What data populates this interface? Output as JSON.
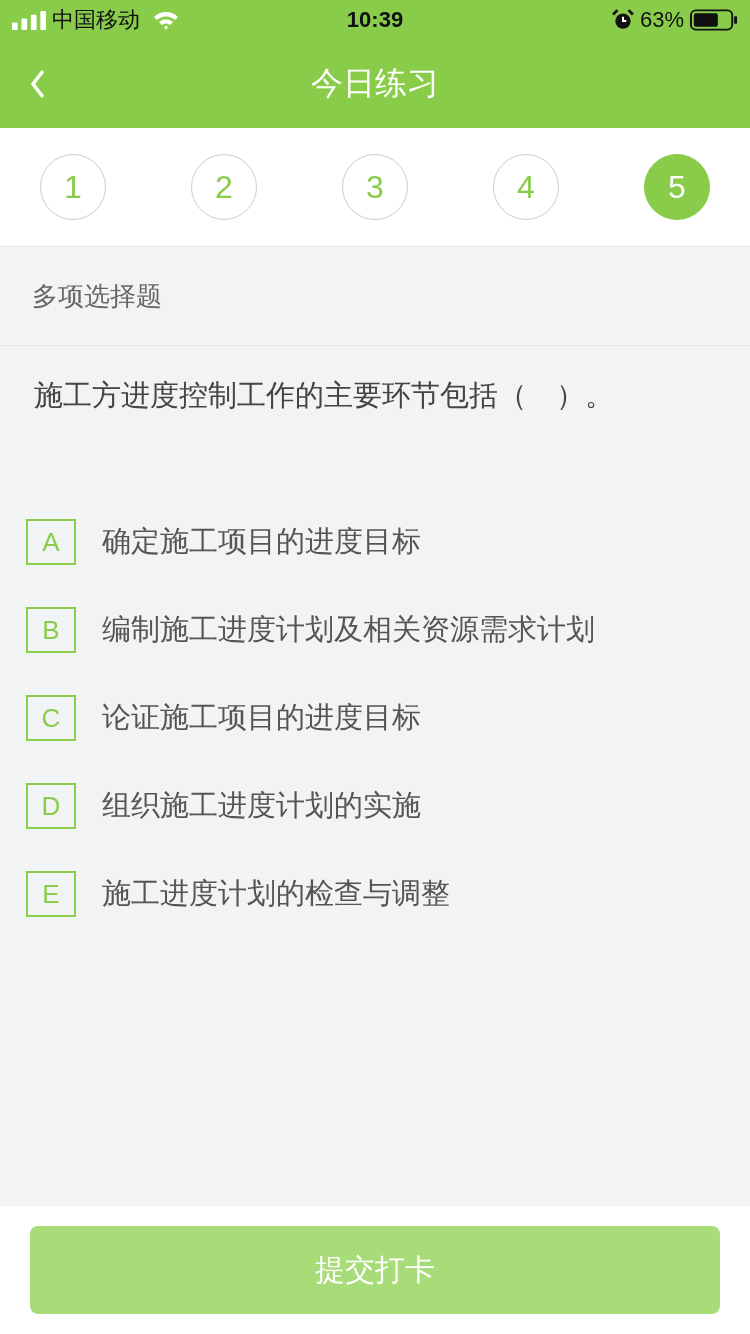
{
  "status_bar": {
    "carrier": "中国移动",
    "time": "10:39",
    "battery_text": "63%"
  },
  "nav": {
    "title": "今日练习"
  },
  "steps": [
    {
      "label": "1",
      "selected": false
    },
    {
      "label": "2",
      "selected": false
    },
    {
      "label": "3",
      "selected": false
    },
    {
      "label": "4",
      "selected": false
    },
    {
      "label": "5",
      "selected": true
    }
  ],
  "question": {
    "type_label": "多项选择题",
    "text": "施工方进度控制工作的主要环节包括（　）。",
    "options": [
      {
        "letter": "A",
        "text": "确定施工项目的进度目标",
        "selected": false
      },
      {
        "letter": "B",
        "text": "编制施工进度计划及相关资源需求计划",
        "selected": false
      },
      {
        "letter": "C",
        "text": "论证施工项目的进度目标",
        "selected": false
      },
      {
        "letter": "D",
        "text": "组织施工进度计划的实施",
        "selected": false
      },
      {
        "letter": "E",
        "text": "施工进度计划的检查与调整",
        "selected": false
      }
    ]
  },
  "submit": {
    "label": "提交打卡",
    "disabled": true
  }
}
